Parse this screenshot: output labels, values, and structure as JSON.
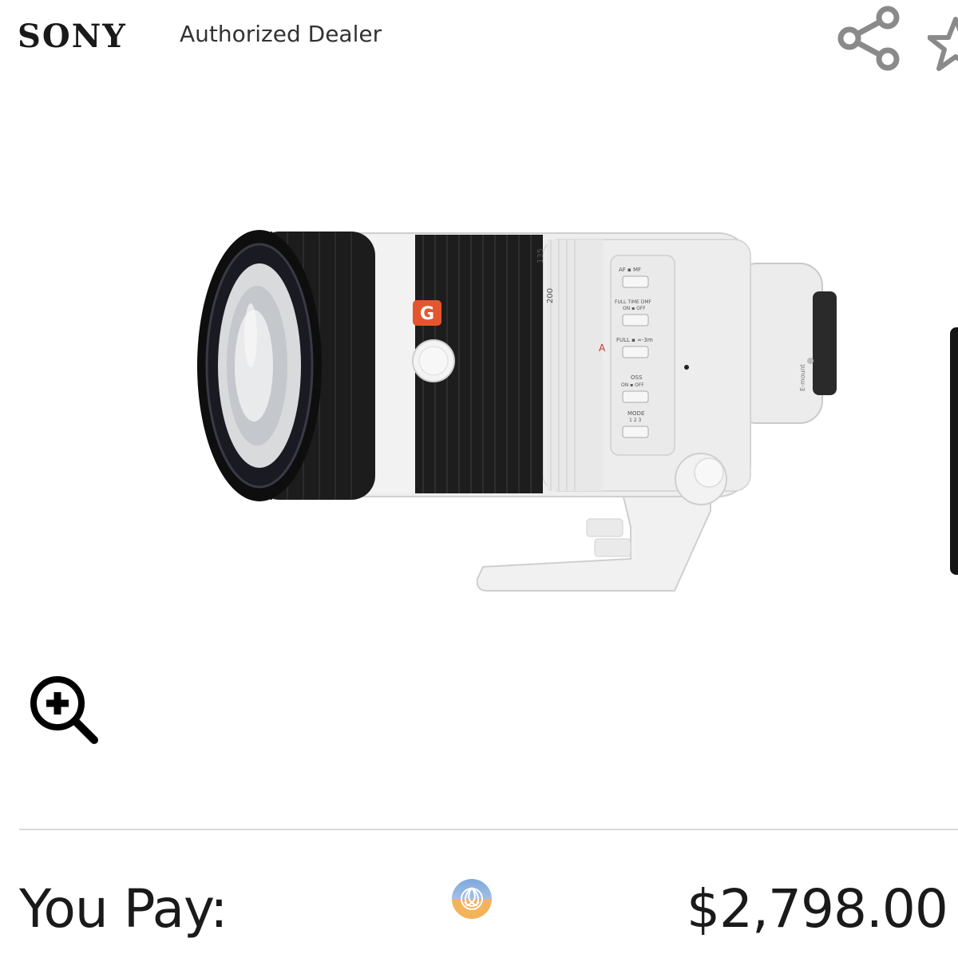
{
  "header": {
    "brand": "SONY",
    "tagline": "Authorized Dealer",
    "share_icon": "share-icon",
    "favorite_icon": "star-outline-icon"
  },
  "product": {
    "lens_labels": {
      "g_badge": "G",
      "focal_200": "200",
      "focal_135": "135",
      "af_mf": "AF ▪ MF",
      "full_time_dmf": "FULL TIME DMF",
      "on_off": "ON ▪ OFF",
      "full_range": "FULL ▪ ∞-3m",
      "oss": "OSS",
      "mode": "MODE",
      "mode_values": "1 2 3",
      "mount": "E-mount"
    },
    "zoom_icon": "zoom-in-icon"
  },
  "price": {
    "label": "You Pay:",
    "amount": "$2,798.00",
    "badge_icon": "triquetra-badge-icon"
  },
  "colors": {
    "text": "#1a1a1a",
    "lens_body": "#ebebeb",
    "lens_rubber": "#1c1c1c",
    "g_badge": "#e4572e",
    "badge_blue": "#7fa9dc",
    "badge_orange": "#f2b35a"
  }
}
